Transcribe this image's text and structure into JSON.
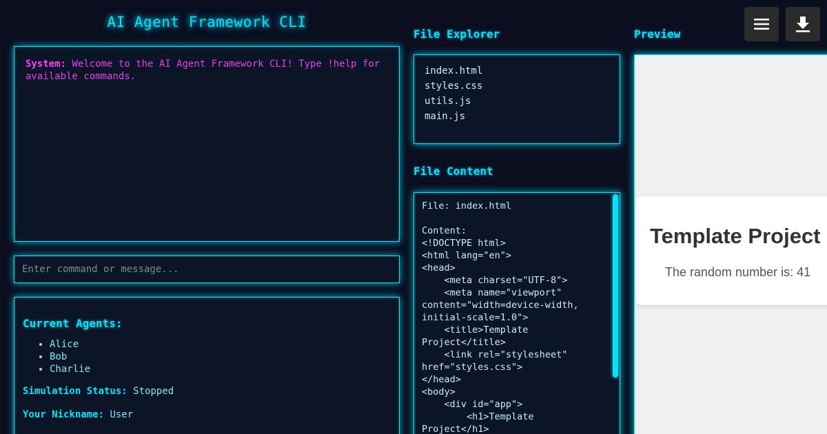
{
  "header": {
    "title": "AI Agent Framework CLI"
  },
  "chat": {
    "messages": [
      {
        "sender": "System:",
        "text": "Welcome to the AI Agent Framework CLI! Type !help for available commands."
      }
    ]
  },
  "command": {
    "placeholder": "Enter command or message..."
  },
  "status": {
    "agents_heading": "Current Agents:",
    "agents": [
      "Alice",
      "Bob",
      "Charlie"
    ],
    "simulation_label": "Simulation Status:",
    "simulation_value": "Stopped",
    "nickname_label": "Your Nickname:",
    "nickname_value": "User"
  },
  "explorer": {
    "title": "File Explorer",
    "files": [
      "index.html",
      "styles.css",
      "utils.js",
      "main.js"
    ]
  },
  "file_content": {
    "title": "File Content",
    "text": "File: index.html\n\nContent:\n<!DOCTYPE html>\n<html lang=\"en\">\n<head>\n    <meta charset=\"UTF-8\">\n    <meta name=\"viewport\" content=\"width=device-width, initial-scale=1.0\">\n    <title>Template Project</title>\n    <link rel=\"stylesheet\" href=\"styles.css\">\n</head>\n<body>\n    <div id=\"app\">\n        <h1>Template Project</h1>"
  },
  "preview": {
    "title": "Preview",
    "heading": "Template Project",
    "paragraph": "The random number is: 41"
  },
  "toolbar": {
    "menu_icon": "hamburger-menu-icon",
    "download_icon": "download-icon"
  },
  "colors": {
    "accent": "#00e5ff",
    "system_text": "#e83ee8",
    "background": "#0a0e1f"
  }
}
